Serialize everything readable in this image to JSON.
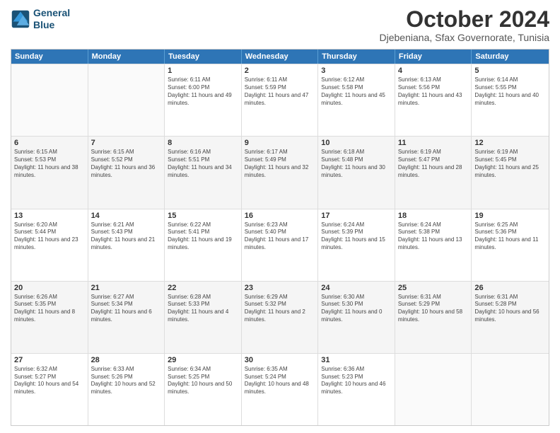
{
  "logo": {
    "line1": "General",
    "line2": "Blue"
  },
  "title": "October 2024",
  "subtitle": "Djebeniana, Sfax Governorate, Tunisia",
  "header_days": [
    "Sunday",
    "Monday",
    "Tuesday",
    "Wednesday",
    "Thursday",
    "Friday",
    "Saturday"
  ],
  "weeks": [
    [
      {
        "day": "",
        "sunrise": "",
        "sunset": "",
        "daylight": ""
      },
      {
        "day": "",
        "sunrise": "",
        "sunset": "",
        "daylight": ""
      },
      {
        "day": "1",
        "sunrise": "Sunrise: 6:11 AM",
        "sunset": "Sunset: 6:00 PM",
        "daylight": "Daylight: 11 hours and 49 minutes."
      },
      {
        "day": "2",
        "sunrise": "Sunrise: 6:11 AM",
        "sunset": "Sunset: 5:59 PM",
        "daylight": "Daylight: 11 hours and 47 minutes."
      },
      {
        "day": "3",
        "sunrise": "Sunrise: 6:12 AM",
        "sunset": "Sunset: 5:58 PM",
        "daylight": "Daylight: 11 hours and 45 minutes."
      },
      {
        "day": "4",
        "sunrise": "Sunrise: 6:13 AM",
        "sunset": "Sunset: 5:56 PM",
        "daylight": "Daylight: 11 hours and 43 minutes."
      },
      {
        "day": "5",
        "sunrise": "Sunrise: 6:14 AM",
        "sunset": "Sunset: 5:55 PM",
        "daylight": "Daylight: 11 hours and 40 minutes."
      }
    ],
    [
      {
        "day": "6",
        "sunrise": "Sunrise: 6:15 AM",
        "sunset": "Sunset: 5:53 PM",
        "daylight": "Daylight: 11 hours and 38 minutes."
      },
      {
        "day": "7",
        "sunrise": "Sunrise: 6:15 AM",
        "sunset": "Sunset: 5:52 PM",
        "daylight": "Daylight: 11 hours and 36 minutes."
      },
      {
        "day": "8",
        "sunrise": "Sunrise: 6:16 AM",
        "sunset": "Sunset: 5:51 PM",
        "daylight": "Daylight: 11 hours and 34 minutes."
      },
      {
        "day": "9",
        "sunrise": "Sunrise: 6:17 AM",
        "sunset": "Sunset: 5:49 PM",
        "daylight": "Daylight: 11 hours and 32 minutes."
      },
      {
        "day": "10",
        "sunrise": "Sunrise: 6:18 AM",
        "sunset": "Sunset: 5:48 PM",
        "daylight": "Daylight: 11 hours and 30 minutes."
      },
      {
        "day": "11",
        "sunrise": "Sunrise: 6:19 AM",
        "sunset": "Sunset: 5:47 PM",
        "daylight": "Daylight: 11 hours and 28 minutes."
      },
      {
        "day": "12",
        "sunrise": "Sunrise: 6:19 AM",
        "sunset": "Sunset: 5:45 PM",
        "daylight": "Daylight: 11 hours and 25 minutes."
      }
    ],
    [
      {
        "day": "13",
        "sunrise": "Sunrise: 6:20 AM",
        "sunset": "Sunset: 5:44 PM",
        "daylight": "Daylight: 11 hours and 23 minutes."
      },
      {
        "day": "14",
        "sunrise": "Sunrise: 6:21 AM",
        "sunset": "Sunset: 5:43 PM",
        "daylight": "Daylight: 11 hours and 21 minutes."
      },
      {
        "day": "15",
        "sunrise": "Sunrise: 6:22 AM",
        "sunset": "Sunset: 5:41 PM",
        "daylight": "Daylight: 11 hours and 19 minutes."
      },
      {
        "day": "16",
        "sunrise": "Sunrise: 6:23 AM",
        "sunset": "Sunset: 5:40 PM",
        "daylight": "Daylight: 11 hours and 17 minutes."
      },
      {
        "day": "17",
        "sunrise": "Sunrise: 6:24 AM",
        "sunset": "Sunset: 5:39 PM",
        "daylight": "Daylight: 11 hours and 15 minutes."
      },
      {
        "day": "18",
        "sunrise": "Sunrise: 6:24 AM",
        "sunset": "Sunset: 5:38 PM",
        "daylight": "Daylight: 11 hours and 13 minutes."
      },
      {
        "day": "19",
        "sunrise": "Sunrise: 6:25 AM",
        "sunset": "Sunset: 5:36 PM",
        "daylight": "Daylight: 11 hours and 11 minutes."
      }
    ],
    [
      {
        "day": "20",
        "sunrise": "Sunrise: 6:26 AM",
        "sunset": "Sunset: 5:35 PM",
        "daylight": "Daylight: 11 hours and 8 minutes."
      },
      {
        "day": "21",
        "sunrise": "Sunrise: 6:27 AM",
        "sunset": "Sunset: 5:34 PM",
        "daylight": "Daylight: 11 hours and 6 minutes."
      },
      {
        "day": "22",
        "sunrise": "Sunrise: 6:28 AM",
        "sunset": "Sunset: 5:33 PM",
        "daylight": "Daylight: 11 hours and 4 minutes."
      },
      {
        "day": "23",
        "sunrise": "Sunrise: 6:29 AM",
        "sunset": "Sunset: 5:32 PM",
        "daylight": "Daylight: 11 hours and 2 minutes."
      },
      {
        "day": "24",
        "sunrise": "Sunrise: 6:30 AM",
        "sunset": "Sunset: 5:30 PM",
        "daylight": "Daylight: 11 hours and 0 minutes."
      },
      {
        "day": "25",
        "sunrise": "Sunrise: 6:31 AM",
        "sunset": "Sunset: 5:29 PM",
        "daylight": "Daylight: 10 hours and 58 minutes."
      },
      {
        "day": "26",
        "sunrise": "Sunrise: 6:31 AM",
        "sunset": "Sunset: 5:28 PM",
        "daylight": "Daylight: 10 hours and 56 minutes."
      }
    ],
    [
      {
        "day": "27",
        "sunrise": "Sunrise: 6:32 AM",
        "sunset": "Sunset: 5:27 PM",
        "daylight": "Daylight: 10 hours and 54 minutes."
      },
      {
        "day": "28",
        "sunrise": "Sunrise: 6:33 AM",
        "sunset": "Sunset: 5:26 PM",
        "daylight": "Daylight: 10 hours and 52 minutes."
      },
      {
        "day": "29",
        "sunrise": "Sunrise: 6:34 AM",
        "sunset": "Sunset: 5:25 PM",
        "daylight": "Daylight: 10 hours and 50 minutes."
      },
      {
        "day": "30",
        "sunrise": "Sunrise: 6:35 AM",
        "sunset": "Sunset: 5:24 PM",
        "daylight": "Daylight: 10 hours and 48 minutes."
      },
      {
        "day": "31",
        "sunrise": "Sunrise: 6:36 AM",
        "sunset": "Sunset: 5:23 PM",
        "daylight": "Daylight: 10 hours and 46 minutes."
      },
      {
        "day": "",
        "sunrise": "",
        "sunset": "",
        "daylight": ""
      },
      {
        "day": "",
        "sunrise": "",
        "sunset": "",
        "daylight": ""
      }
    ]
  ]
}
